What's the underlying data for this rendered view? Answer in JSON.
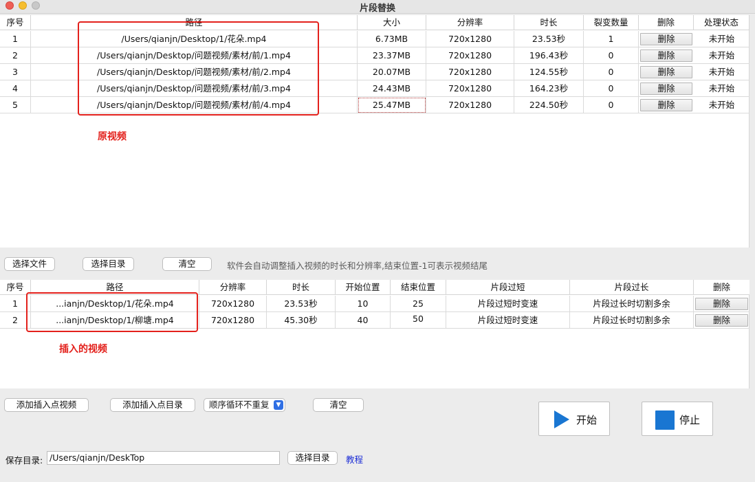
{
  "window": {
    "title": "片段替换"
  },
  "top_table": {
    "columns": [
      "序号",
      "路径",
      "大小",
      "分辨率",
      "时长",
      "裂变数量",
      "删除",
      "处理状态"
    ],
    "rows": [
      {
        "index": "1",
        "path": "/Users/qianjn/Desktop/1/花朵.mp4",
        "size": "6.73MB",
        "resolution": "720x1280",
        "duration": "23.53秒",
        "count": "1",
        "delete": "删除",
        "status": "未开始"
      },
      {
        "index": "2",
        "path": "/Users/qianjn/Desktop/问题视频/素材/前/1.mp4",
        "size": "23.37MB",
        "resolution": "720x1280",
        "duration": "196.43秒",
        "count": "0",
        "delete": "删除",
        "status": "未开始"
      },
      {
        "index": "3",
        "path": "/Users/qianjn/Desktop/问题视频/素材/前/2.mp4",
        "size": "20.07MB",
        "resolution": "720x1280",
        "duration": "124.55秒",
        "count": "0",
        "delete": "删除",
        "status": "未开始"
      },
      {
        "index": "4",
        "path": "/Users/qianjn/Desktop/问题视频/素材/前/3.mp4",
        "size": "24.43MB",
        "resolution": "720x1280",
        "duration": "164.23秒",
        "count": "0",
        "delete": "删除",
        "status": "未开始"
      },
      {
        "index": "5",
        "path": "/Users/qianjn/Desktop/问题视频/素材/前/4.mp4",
        "size": "25.47MB",
        "resolution": "720x1280",
        "duration": "224.50秒",
        "count": "0",
        "delete": "删除",
        "status": "未开始"
      }
    ],
    "annotation": "原视频"
  },
  "mid_toolbar": {
    "select_file": "选择文件",
    "select_dir": "选择目录",
    "clear": "清空",
    "hint": "软件会自动调整插入视频的时长和分辨率,结束位置-1可表示视频结尾"
  },
  "insert_table": {
    "columns": [
      "序号",
      "路径",
      "分辨率",
      "时长",
      "开始位置",
      "结束位置",
      "片段过短",
      "片段过长",
      "删除"
    ],
    "rows": [
      {
        "index": "1",
        "path": "...ianjn/Desktop/1/花朵.mp4",
        "resolution": "720x1280",
        "duration": "23.53秒",
        "start": "10",
        "end": "25",
        "too_short": "片段过短时变速",
        "too_long": "片段过长时切割多余",
        "delete": "删除"
      },
      {
        "index": "2",
        "path": "...ianjn/Desktop/1/柳塘.mp4",
        "resolution": "720x1280",
        "duration": "45.30秒",
        "start": "40",
        "end": "50",
        "too_short": "片段过短时变速",
        "too_long": "片段过长时切割多余",
        "delete": "删除"
      }
    ],
    "annotation": "插入的视频"
  },
  "bottom_toolbar": {
    "add_insert_video": "添加插入点视频",
    "add_insert_dir": "添加插入点目录",
    "order_mode": "顺序循环不重复",
    "clear": "清空",
    "start": "开始",
    "stop": "停止"
  },
  "save": {
    "label": "保存目录:",
    "path": "/Users/qianjn/DeskTop",
    "select_dir": "选择目录",
    "tutorial": "教程"
  },
  "colors": {
    "annotation_red": "#e3201b",
    "accent_blue": "#1976d2",
    "link_blue": "#1e2fd6"
  }
}
